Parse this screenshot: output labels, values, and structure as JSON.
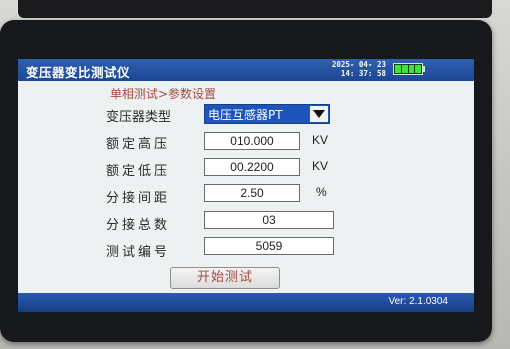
{
  "window": {
    "title": "变压器变比测试仪",
    "date": "2025- 04- 23",
    "time": "14: 37: 58",
    "battery_level": 1.0
  },
  "breadcrumb": "单相测试>参数设置",
  "form": {
    "transformer_type": {
      "label": "变压器类型",
      "value": "电压互感器PT"
    },
    "rated_high_voltage": {
      "label": "额定高压",
      "value": "010.000",
      "unit": "KV"
    },
    "rated_low_voltage": {
      "label": "额定低压",
      "value": "00.2200",
      "unit": "KV"
    },
    "tap_spacing": {
      "label": "分接间距",
      "value": "2.50",
      "unit": "%"
    },
    "tap_total": {
      "label": "分接总数",
      "value": "03"
    },
    "test_number": {
      "label": "测试编号",
      "value": "5059"
    }
  },
  "start_button_label": "开始测试",
  "version": "Ver: 2.1.0304",
  "colors": {
    "titlebar": "#1c4693",
    "accent_text": "#a64a40",
    "select_bg": "#1f55b8",
    "battery_fill": "#3ee33e"
  }
}
